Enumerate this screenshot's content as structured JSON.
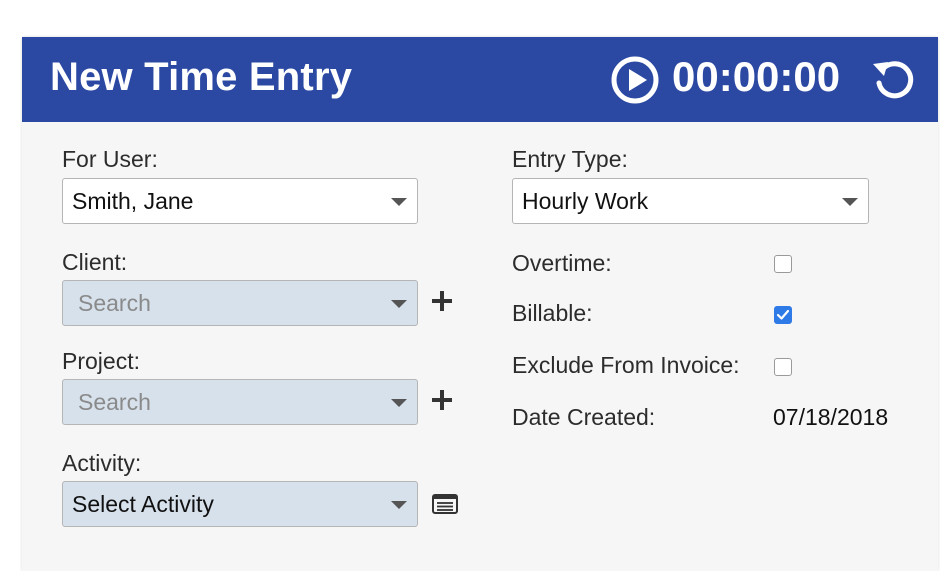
{
  "header": {
    "title": "New Time Entry",
    "timer": "00:00:00",
    "play_icon": "play-circle-icon",
    "reset_icon": "reset-icon",
    "background": "#2b49a3"
  },
  "left": {
    "user_label": "For User:",
    "user_value": "Smith, Jane",
    "client_label": "Client:",
    "client_placeholder": "Search",
    "project_label": "Project:",
    "project_placeholder": "Search",
    "activity_label": "Activity:",
    "activity_value": "Select Activity"
  },
  "right": {
    "entry_type_label": "Entry Type:",
    "entry_type_value": "Hourly Work",
    "overtime_label": "Overtime:",
    "overtime_checked": false,
    "billable_label": "Billable:",
    "billable_checked": true,
    "exclude_label": "Exclude From Invoice:",
    "exclude_checked": false,
    "date_created_label": "Date Created:",
    "date_created_value": "07/18/2018"
  },
  "colors": {
    "accent": "#2b49a3",
    "disabled_field": "#d6e1ec",
    "checkbox_checked": "#2e7ae6"
  }
}
